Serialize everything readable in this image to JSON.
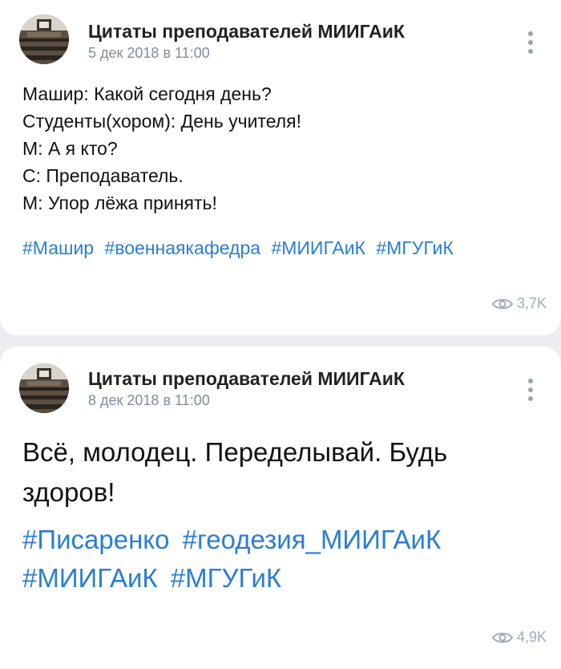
{
  "posts": [
    {
      "author": "Цитаты преподавателей МИИГАиК",
      "date": "5 дек 2018 в 11:00",
      "lines": [
        "Машир: Какой сегодня день?",
        "Студенты(хором): День учителя!",
        "М: А я кто?",
        "С: Преподаватель.",
        "М: Упор лёжа принять!"
      ],
      "tags": [
        "#Машир",
        "#военнаякафедра",
        "#МИИГАиК",
        "#МГУГиК"
      ],
      "views": "3,7K"
    },
    {
      "author": "Цитаты преподавателей МИИГАиК",
      "date": "8 дек 2018 в 11:00",
      "text": "Всё, молодец. Переделывай. Будь здоров!",
      "tags": [
        "#Писаренко",
        "#геодезия_МИИГАиК",
        "#МИИГАиК",
        "#МГУГиК"
      ],
      "views": "4,9K"
    }
  ],
  "colors": {
    "link": "#2a7dd4",
    "meta": "#818c99",
    "background": "#ebedf0"
  },
  "icons": {
    "menu": "more-vertical-icon",
    "views": "eye-icon"
  }
}
